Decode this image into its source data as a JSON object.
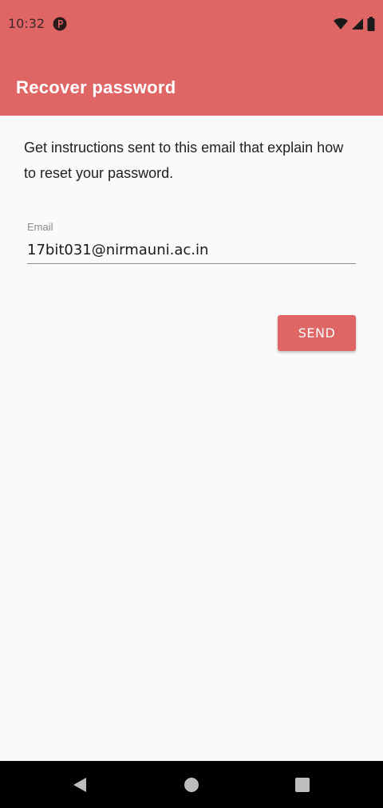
{
  "status_bar": {
    "time": "10:32",
    "app_icon": "app-notification-icon",
    "icons": [
      "wifi-icon",
      "signal-icon",
      "battery-icon"
    ]
  },
  "app_bar": {
    "title": "Recover password"
  },
  "form": {
    "description": "Get instructions sent to this email that explain how to reset your password.",
    "email_label": "Email",
    "email_value": "17bit031@nirmauni.ac.in",
    "send_label": "SEND"
  },
  "nav_bar": {
    "buttons": [
      "back-icon",
      "home-icon",
      "recents-icon"
    ]
  },
  "colors": {
    "accent": "#e06666",
    "background": "#fafafa",
    "nav_background": "#000000"
  }
}
